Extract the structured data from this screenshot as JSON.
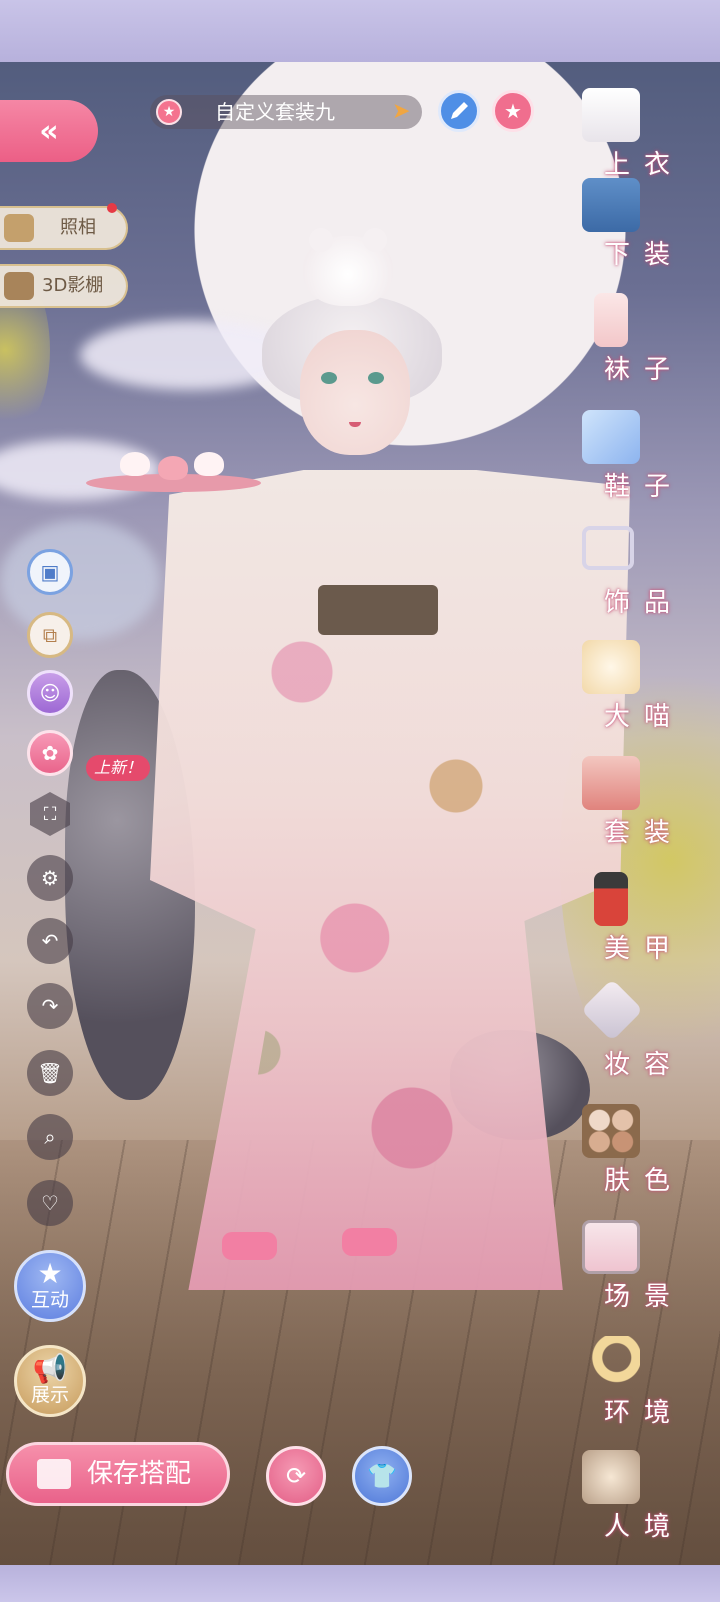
{
  "outfit": {
    "name": "自定义套装九"
  },
  "left_menu": {
    "back_glyph": "«",
    "photo_label": "照相",
    "studio_label": "3D影棚",
    "new_tag": "上新！",
    "interact_label": "互动",
    "show_label": "展示"
  },
  "bottom": {
    "save_label": "保存搭配"
  },
  "categories": [
    {
      "label": "上衣",
      "icon": "top-icon"
    },
    {
      "label": "下装",
      "icon": "shorts-icon"
    },
    {
      "label": "袜子",
      "icon": "sock-icon"
    },
    {
      "label": "鞋子",
      "icon": "shoe-icon"
    },
    {
      "label": "饰品",
      "icon": "accessory-icon"
    },
    {
      "label": "大喵",
      "icon": "cat-icon"
    },
    {
      "label": "套装",
      "icon": "outfit-set-icon"
    },
    {
      "label": "美甲",
      "icon": "nail-polish-icon"
    },
    {
      "label": "妆容",
      "icon": "makeup-icon"
    },
    {
      "label": "肤色",
      "icon": "skin-palette-icon"
    },
    {
      "label": "场景",
      "icon": "scene-icon"
    },
    {
      "label": "环境",
      "icon": "moon-environment-icon"
    },
    {
      "label": "人境",
      "icon": "person-scene-icon"
    }
  ],
  "colors": {
    "accent_pink": "#ec5f86",
    "accent_blue": "#4f8fe6",
    "gold": "#d7b983"
  }
}
